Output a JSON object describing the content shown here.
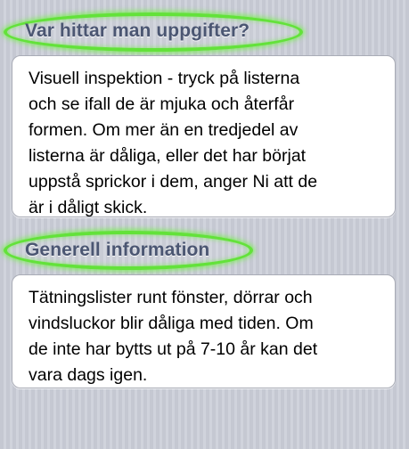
{
  "sections": [
    {
      "header": "Var hittar man uppgifter?",
      "body": "Visuell inspektion - tryck på listerna\noch se ifall de är mjuka och återfår\nformen. Om mer än en tredjedel av\nlisterna är dåliga, eller det har börjat\nuppstå sprickor i dem, anger Ni att de\när i dåligt skick."
    },
    {
      "header": "Generell information",
      "body": "Tätningslister runt fönster, dörrar och\nvindsluckor blir dåliga med tiden. Om\nde inte har bytts ut på 7-10 år kan det\nvara dags igen."
    }
  ],
  "colors": {
    "highlight": "#63e23a",
    "header_text": "#4b5672",
    "background": "#c9ccd6",
    "card": "#ffffff"
  }
}
